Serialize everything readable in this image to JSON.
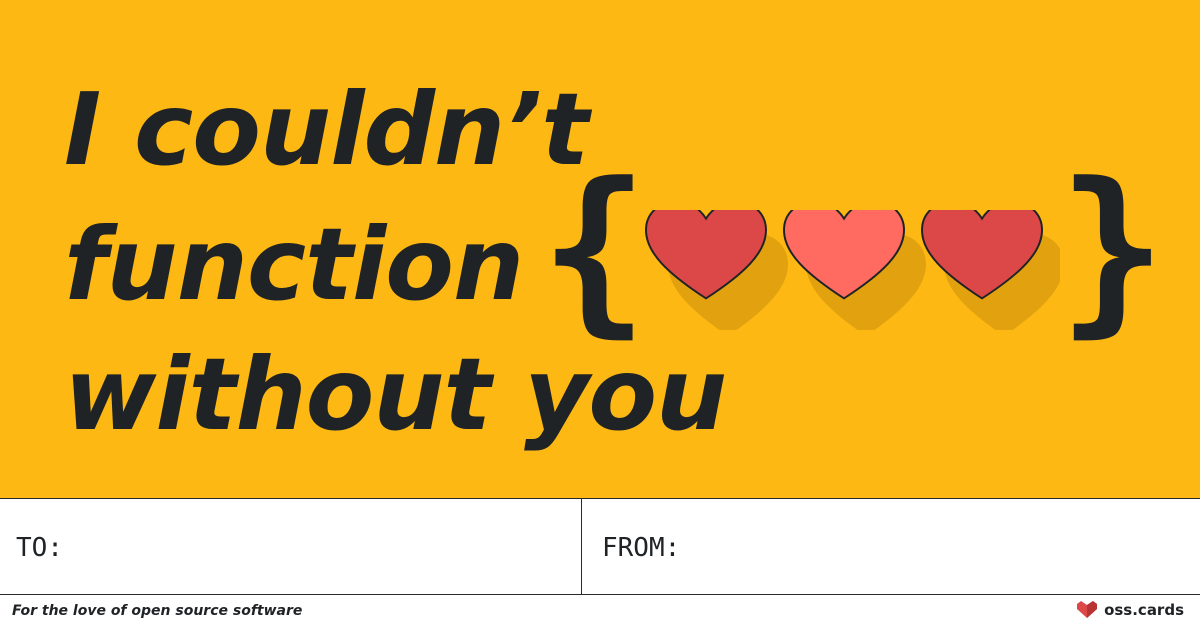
{
  "headline": {
    "line1": "I couldn’t",
    "line2": "function",
    "line3": "without you",
    "brace_open": "{",
    "brace_close": "}"
  },
  "hearts": [
    "heart-icon",
    "heart-icon",
    "heart-icon"
  ],
  "colors": {
    "background": "#FDB813",
    "text": "#1F2326",
    "heart_red": "#DC4847",
    "heart_coral": "#FF6B61"
  },
  "fields": {
    "to_label": "TO:",
    "from_label": "FROM:"
  },
  "footer": {
    "tagline": "For the love of open source software",
    "brand": "oss.cards"
  }
}
